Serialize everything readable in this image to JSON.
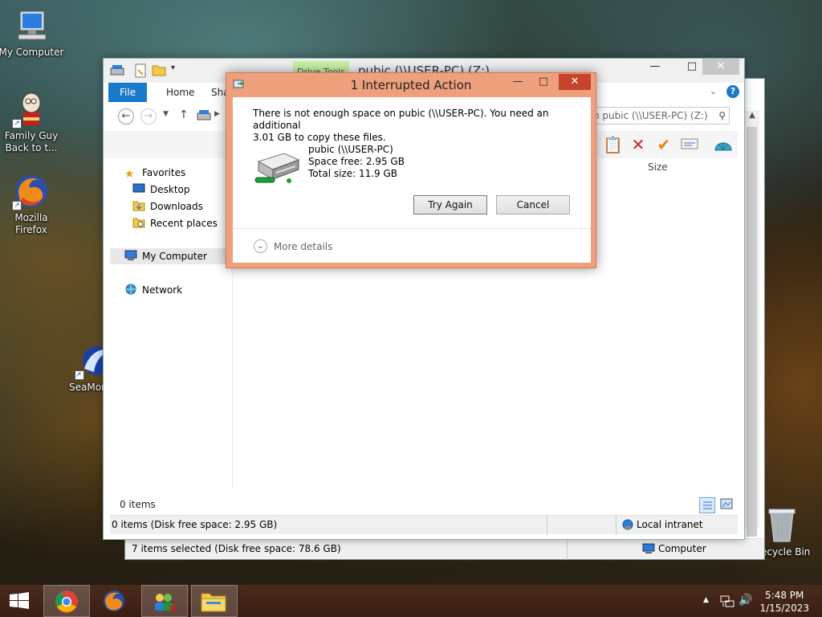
{
  "desktop": {
    "icons": [
      {
        "label": "My Computer",
        "icon": "computer-icon"
      },
      {
        "label": "Family Guy Back to t...",
        "line1": "Family Guy",
        "line2": "Back to t...",
        "icon": "family-guy-icon"
      },
      {
        "label": "Mozilla Firefox",
        "line1": "Mozilla",
        "line2": "Firefox",
        "icon": "firefox-icon"
      },
      {
        "label": "SeaMon",
        "icon": "seamonkey-icon"
      },
      {
        "label": "ecycle Bin",
        "icon": "recycle-bin-icon"
      }
    ]
  },
  "explorer_back": {
    "status_left": "7 items selected (Disk free space: 78.6 GB)",
    "status_right": "Computer"
  },
  "explorer": {
    "title": "pubic (\\\\USER-PC) (Z:)",
    "drive_tools": "Drive Tools",
    "tabs": [
      "File",
      "Home",
      "Sha"
    ],
    "search_placeholder": "h pubic (\\\\USER-PC) (Z:)",
    "column_size": "Size",
    "nav": {
      "favorites": "Favorites",
      "desktop": "Desktop",
      "downloads": "Downloads",
      "recent": "Recent places",
      "my_computer": "My Computer",
      "network": "Network"
    },
    "items_count": "0 items",
    "status_left": "0 items (Disk free space: 2.95 GB)",
    "status_right": "Local intranet"
  },
  "dialog": {
    "title": "1 Interrupted Action",
    "message_line1": "There is not enough space on pubic (\\\\USER-PC). You need an additional",
    "message_line2": "3.01 GB to copy these files.",
    "drive_name": "pubic (\\\\USER-PC)",
    "space_free": "Space free: 2.95 GB",
    "total_size": "Total size: 11.9 GB",
    "try_again": "Try Again",
    "cancel": "Cancel",
    "more_details": "More details"
  },
  "taskbar": {
    "time": "5:48 PM",
    "date": "1/15/2023"
  }
}
